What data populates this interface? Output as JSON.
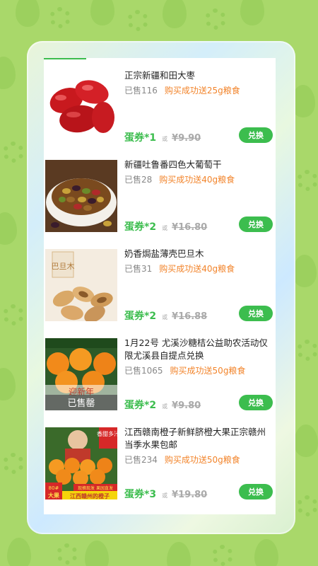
{
  "products": [
    {
      "title": "正宗新疆和田大枣",
      "sold": "已售116",
      "bonus": "购买成功送25g粮食",
      "coupon": "蛋券*1",
      "or": "或",
      "orig_price": "¥9.90",
      "button": "兑换"
    },
    {
      "title": "新疆吐鲁番四色大葡萄干",
      "sold": "已售28",
      "bonus": "购买成功送40g粮食",
      "coupon": "蛋券*2",
      "or": "或",
      "orig_price": "¥16.80",
      "button": "兑换"
    },
    {
      "title": "奶香焗盐薄壳巴旦木",
      "sold": "已售31",
      "bonus": "购买成功送40g粮食",
      "coupon": "蛋券*2",
      "or": "或",
      "orig_price": "¥16.88",
      "button": "兑换",
      "thumb_text": "巴旦木"
    },
    {
      "title": "1月22号 尤溪沙糖桔公益助农活动仅限尤溪县自提点兑换",
      "sold": "已售1065",
      "bonus": "购买成功送50g粮食",
      "coupon": "蛋券*2",
      "or": "或",
      "orig_price": "¥9.80",
      "button": "兑换",
      "thumb_overlay": "已售罄",
      "thumb_text": "迎新年"
    },
    {
      "title": "江西赣南橙子新鲜脐橙大果正宗赣州当季水果包邮",
      "sold": "已售234",
      "bonus": "购买成功送50g粮食",
      "coupon": "蛋券*3",
      "or": "或",
      "orig_price": "¥19.80",
      "button": "兑换",
      "thumb_tag": "香甜多汁",
      "thumb_size": "80#",
      "thumb_big": "大果",
      "thumb_banner": "江西赣州的橙子",
      "thumb_ribbon": "现摘现发 果园直发"
    }
  ],
  "colors": {
    "accent": "#3cbd4e",
    "bonus": "#f2842b",
    "background": "#a9d86a"
  }
}
